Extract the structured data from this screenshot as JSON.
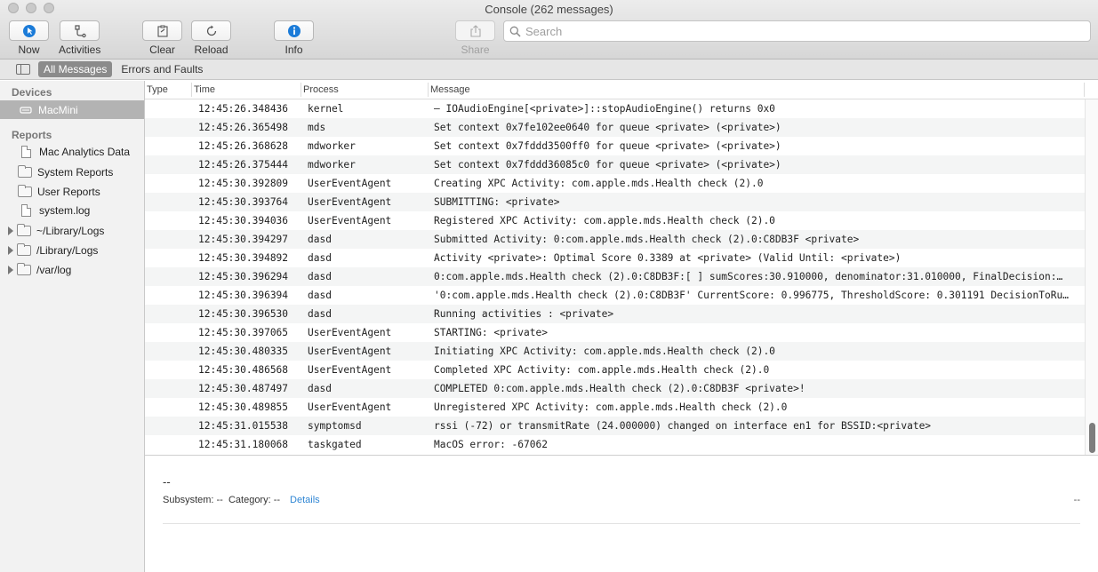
{
  "window": {
    "title": "Console (262 messages)"
  },
  "toolbar": {
    "now": "Now",
    "activities": "Activities",
    "clear": "Clear",
    "reload": "Reload",
    "info": "Info",
    "share": "Share",
    "search_placeholder": "Search"
  },
  "filter": {
    "all_messages": "All Messages",
    "errors_faults": "Errors and Faults"
  },
  "sidebar": {
    "devices_header": "Devices",
    "device": "MacMini",
    "reports_header": "Reports",
    "reports": [
      "Mac Analytics Data",
      "System Reports",
      "User Reports",
      "system.log",
      "~/Library/Logs",
      "/Library/Logs",
      "/var/log"
    ]
  },
  "table": {
    "columns": [
      "Type",
      "Time",
      "Process",
      "Message"
    ],
    "rows": [
      {
        "time": "12:45:26.348436",
        "process": "kernel",
        "message": "– IOAudioEngine[<private>]::stopAudioEngine() returns 0x0"
      },
      {
        "time": "12:45:26.365498",
        "process": "mds",
        "message": "Set context 0x7fe102ee0640 for queue <private> (<private>)"
      },
      {
        "time": "12:45:26.368628",
        "process": "mdworker",
        "message": "Set context 0x7fddd3500ff0 for queue <private> (<private>)"
      },
      {
        "time": "12:45:26.375444",
        "process": "mdworker",
        "message": "Set context 0x7fddd36085c0 for queue <private> (<private>)"
      },
      {
        "time": "12:45:30.392809",
        "process": "UserEventAgent",
        "message": "Creating XPC Activity: com.apple.mds.Health check (2).0"
      },
      {
        "time": "12:45:30.393764",
        "process": "UserEventAgent",
        "message": "SUBMITTING: <private>"
      },
      {
        "time": "12:45:30.394036",
        "process": "UserEventAgent",
        "message": "Registered XPC Activity: com.apple.mds.Health check (2).0"
      },
      {
        "time": "12:45:30.394297",
        "process": "dasd",
        "message": "Submitted Activity: 0:com.apple.mds.Health check (2).0:C8DB3F <private>"
      },
      {
        "time": "12:45:30.394892",
        "process": "dasd",
        "message": "Activity <private>: Optimal Score 0.3389 at <private> (Valid Until: <private>)"
      },
      {
        "time": "12:45:30.396294",
        "process": "dasd",
        "message": "0:com.apple.mds.Health check (2).0:C8DB3F:[  ] sumScores:30.910000, denominator:31.010000, FinalDecision:…"
      },
      {
        "time": "12:45:30.396394",
        "process": "dasd",
        "message": "'0:com.apple.mds.Health check (2).0:C8DB3F' CurrentScore: 0.996775, ThresholdScore: 0.301191 DecisionToRu…"
      },
      {
        "time": "12:45:30.396530",
        "process": "dasd",
        "message": "Running activities : <private>"
      },
      {
        "time": "12:45:30.397065",
        "process": "UserEventAgent",
        "message": "STARTING: <private>"
      },
      {
        "time": "12:45:30.480335",
        "process": "UserEventAgent",
        "message": "Initiating XPC Activity: com.apple.mds.Health check (2).0"
      },
      {
        "time": "12:45:30.486568",
        "process": "UserEventAgent",
        "message": "Completed XPC Activity: com.apple.mds.Health check (2).0"
      },
      {
        "time": "12:45:30.487497",
        "process": "dasd",
        "message": "COMPLETED 0:com.apple.mds.Health check (2).0:C8DB3F <private>!"
      },
      {
        "time": "12:45:30.489855",
        "process": "UserEventAgent",
        "message": "Unregistered XPC Activity: com.apple.mds.Health check (2).0"
      },
      {
        "time": "12:45:31.015538",
        "process": "symptomsd",
        "message": "rssi (-72) or transmitRate (24.000000) changed on interface en1 for BSSID:<private>"
      },
      {
        "time": "12:45:31.180068",
        "process": "taskgated",
        "message": "MacOS error: -67062"
      }
    ]
  },
  "detail": {
    "top_dash": "--",
    "subsystem": "Subsystem: -- ",
    "category": " Category: --",
    "details": "Details",
    "right_dash": "--"
  },
  "colors": {
    "accent": "#1b7bd8",
    "link": "#2f86d4",
    "selected_sidebar": "#b3b3b3"
  }
}
